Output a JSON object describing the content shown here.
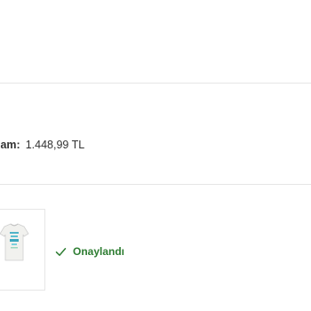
{
  "order": {
    "total_label": "lam:",
    "total_value": "1.448,99 TL"
  },
  "item": {
    "status_text": "Onaylandı",
    "status_icon": "check-icon",
    "thumbnail_icon": "tshirt-thumbnail"
  },
  "colors": {
    "status_green": "#2e7d32",
    "divider": "#e6e6e6",
    "text": "#333333"
  }
}
